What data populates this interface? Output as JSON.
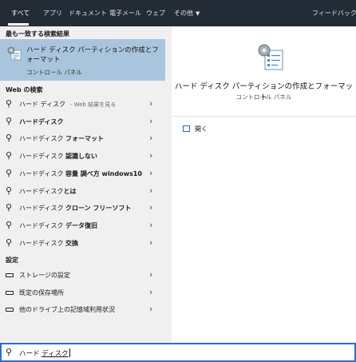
{
  "tabs": [
    {
      "label": "すべて",
      "active": true
    },
    {
      "label": "アプリ"
    },
    {
      "label": "ドキュメント"
    },
    {
      "label": "電子メール"
    },
    {
      "label": "ウェブ"
    },
    {
      "label": "その他"
    }
  ],
  "feedback_label": "フィードバック",
  "best_match": {
    "section": "最も一致する検索結果",
    "title": "ハード ディスク パーティションの作成とフォーマット",
    "subtitle": "コントロール パネル"
  },
  "web_section": "Web の検索",
  "web_results": [
    {
      "prefix": "ハード ディスク",
      "bold": "",
      "hint": "- Web 結果を見る"
    },
    {
      "prefix": "",
      "bold": "ハードディスク",
      "hint": ""
    },
    {
      "prefix": "ハードディスク ",
      "bold": "フォーマット",
      "hint": ""
    },
    {
      "prefix": "ハードディスク ",
      "bold": "認識しない",
      "hint": ""
    },
    {
      "prefix": "ハードディスク ",
      "bold": "容量 調べ方 windows10",
      "hint": ""
    },
    {
      "prefix": "ハードディスク",
      "bold": "とは",
      "hint": ""
    },
    {
      "prefix": "ハードディスク ",
      "bold": "クローン フリーソフト",
      "hint": ""
    },
    {
      "prefix": "ハードディスク ",
      "bold": "データ復旧",
      "hint": ""
    },
    {
      "prefix": "ハードディスク ",
      "bold": "交換",
      "hint": ""
    }
  ],
  "settings_section": "設定",
  "settings_results": [
    {
      "label": "ストレージの設定"
    },
    {
      "label": "既定の保存場所"
    },
    {
      "label": "他のドライブ上の記憶域利用状況"
    }
  ],
  "detail": {
    "title": "ハード ディスク パーティションの作成とフォーマット",
    "subtitle": "コントロール パネル",
    "open_label": "開く"
  },
  "search": {
    "typed": "ハード ",
    "composing": "ディスク"
  }
}
